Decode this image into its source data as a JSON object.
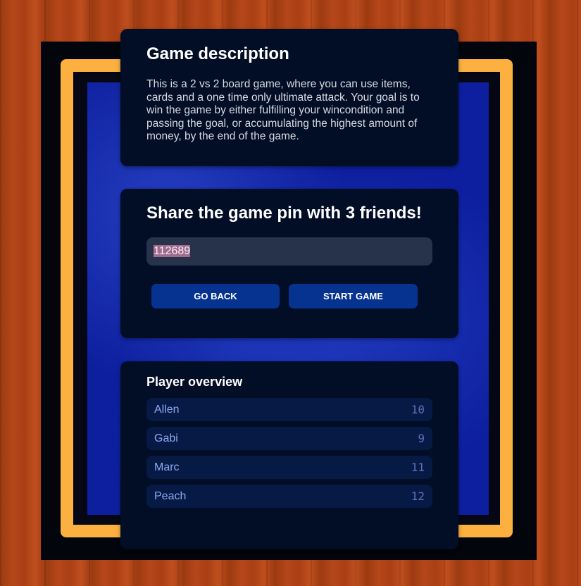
{
  "description": {
    "title": "Game description",
    "text": "This is a 2 vs 2 board game, where you can use items, cards and a one time only ultimate attack. Your goal is to win the game by either fulfilling your wincondition and passing the goal, or accumulating the highest amount of money, by the end of the game."
  },
  "share": {
    "title": "Share the game pin with 3 friends!",
    "pin": "112689",
    "go_back_label": "GO BACK",
    "start_game_label": "START GAME"
  },
  "players": {
    "title": "Player overview",
    "list": [
      {
        "name": "Allen",
        "score": "10"
      },
      {
        "name": "Gabi",
        "score": "9"
      },
      {
        "name": "Marc",
        "score": "11"
      },
      {
        "name": "Peach",
        "score": "12"
      }
    ]
  },
  "colors": {
    "card_bg": "#020d26",
    "button_bg": "#06338f",
    "board_border": "#fbb040",
    "water": "#0d1f9e"
  }
}
